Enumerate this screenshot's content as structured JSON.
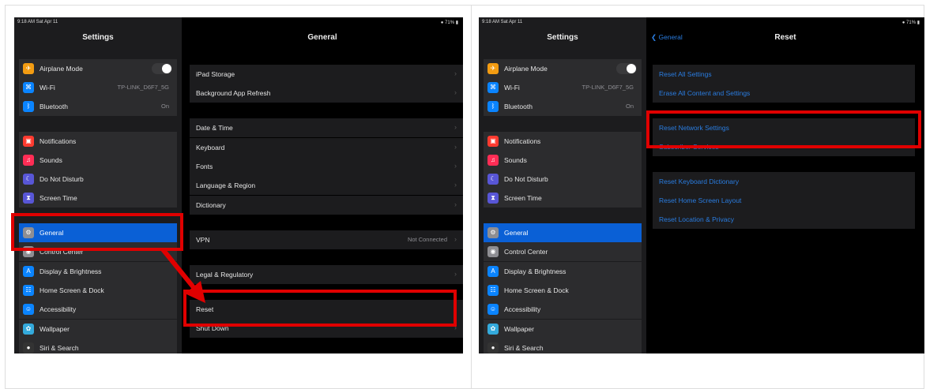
{
  "colors": {
    "accent": "#2a7de1",
    "selected": "#0a60d6",
    "highlight": "#e00000",
    "panel": "#1c1c1e",
    "row": "#2c2c2e"
  },
  "status": {
    "time": "9:18 AM  Sat Apr 11",
    "battery": "71%"
  },
  "left": {
    "sidebar_title": "Settings",
    "detail_title": "General",
    "sidebar": [
      {
        "label": "Airplane Mode",
        "icon": "airplane-icon",
        "color": "#f39c12",
        "toggle": true
      },
      {
        "label": "Wi-Fi",
        "value": "TP-LINK_D6F7_5G",
        "icon": "wifi-icon",
        "color": "#0a84ff"
      },
      {
        "label": "Bluetooth",
        "value": "On",
        "icon": "bluetooth-icon",
        "color": "#0a84ff"
      },
      {
        "label": "Notifications",
        "icon": "notifications-icon",
        "color": "#ff3b30"
      },
      {
        "label": "Sounds",
        "icon": "sounds-icon",
        "color": "#ff2d55"
      },
      {
        "label": "Do Not Disturb",
        "icon": "moon-icon",
        "color": "#5856d6"
      },
      {
        "label": "Screen Time",
        "icon": "hourglass-icon",
        "color": "#5856d6"
      },
      {
        "label": "General",
        "icon": "gear-icon",
        "color": "#8e8e93",
        "selected": true
      },
      {
        "label": "Control Center",
        "icon": "control-center-icon",
        "color": "#8e8e93"
      },
      {
        "label": "Display & Brightness",
        "icon": "display-icon",
        "color": "#0a84ff"
      },
      {
        "label": "Home Screen & Dock",
        "icon": "home-screen-icon",
        "color": "#0a84ff"
      },
      {
        "label": "Accessibility",
        "icon": "accessibility-icon",
        "color": "#0a84ff"
      },
      {
        "label": "Wallpaper",
        "icon": "wallpaper-icon",
        "color": "#34aadc"
      },
      {
        "label": "Siri & Search",
        "icon": "siri-icon",
        "color": "#333333"
      }
    ],
    "detail": [
      {
        "label": "iPad Storage"
      },
      {
        "label": "Background App Refresh"
      },
      {
        "label": "Date & Time"
      },
      {
        "label": "Keyboard"
      },
      {
        "label": "Fonts"
      },
      {
        "label": "Language & Region"
      },
      {
        "label": "Dictionary"
      },
      {
        "label": "VPN",
        "value": "Not Connected"
      },
      {
        "label": "Legal & Regulatory"
      },
      {
        "label": "Reset"
      },
      {
        "label": "Shut Down"
      }
    ]
  },
  "right": {
    "sidebar_title": "Settings",
    "detail_title": "Reset",
    "back_label": "General",
    "sidebar": [
      {
        "label": "Airplane Mode",
        "icon": "airplane-icon",
        "color": "#f39c12",
        "toggle": true
      },
      {
        "label": "Wi-Fi",
        "value": "TP-LINK_D6F7_5G",
        "icon": "wifi-icon",
        "color": "#0a84ff"
      },
      {
        "label": "Bluetooth",
        "value": "On",
        "icon": "bluetooth-icon",
        "color": "#0a84ff"
      },
      {
        "label": "Notifications",
        "icon": "notifications-icon",
        "color": "#ff3b30"
      },
      {
        "label": "Sounds",
        "icon": "sounds-icon",
        "color": "#ff2d55"
      },
      {
        "label": "Do Not Disturb",
        "icon": "moon-icon",
        "color": "#5856d6"
      },
      {
        "label": "Screen Time",
        "icon": "hourglass-icon",
        "color": "#5856d6"
      },
      {
        "label": "General",
        "icon": "gear-icon",
        "color": "#8e8e93",
        "selected": true
      },
      {
        "label": "Control Center",
        "icon": "control-center-icon",
        "color": "#8e8e93"
      },
      {
        "label": "Display & Brightness",
        "icon": "display-icon",
        "color": "#0a84ff"
      },
      {
        "label": "Home Screen & Dock",
        "icon": "home-screen-icon",
        "color": "#0a84ff"
      },
      {
        "label": "Accessibility",
        "icon": "accessibility-icon",
        "color": "#0a84ff"
      },
      {
        "label": "Wallpaper",
        "icon": "wallpaper-icon",
        "color": "#34aadc"
      },
      {
        "label": "Siri & Search",
        "icon": "siri-icon",
        "color": "#333333"
      }
    ],
    "detail": [
      {
        "label": "Reset All Settings"
      },
      {
        "label": "Erase All Content and Settings"
      },
      {
        "label": "Reset Network Settings"
      },
      {
        "label": "Subscriber Services"
      },
      {
        "label": "Reset Keyboard Dictionary"
      },
      {
        "label": "Reset Home Screen Layout"
      },
      {
        "label": "Reset Location & Privacy"
      }
    ]
  }
}
